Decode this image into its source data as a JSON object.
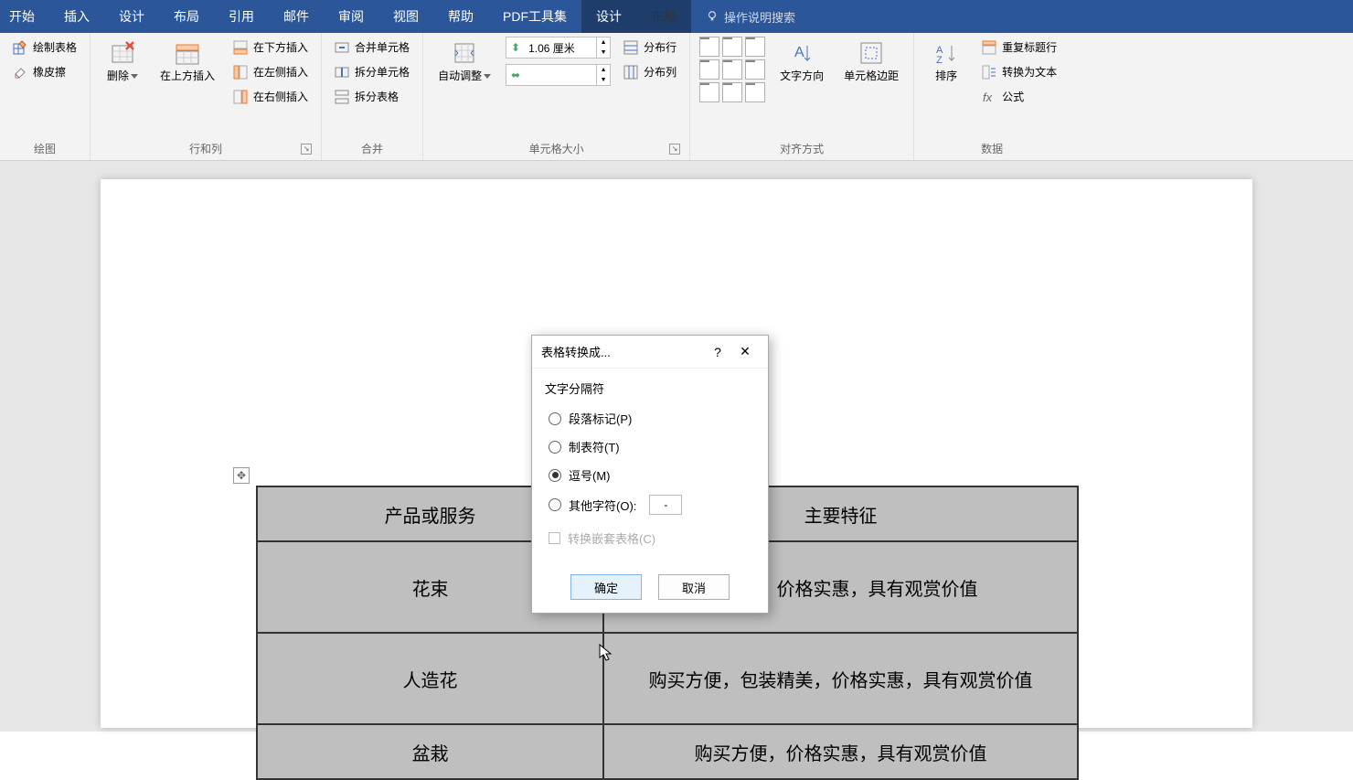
{
  "tabs": {
    "start": "开始",
    "insert": "插入",
    "design": "设计",
    "layout": "布局",
    "references": "引用",
    "mail": "邮件",
    "review": "审阅",
    "view": "视图",
    "help": "帮助",
    "pdf": "PDF工具集",
    "tbl_design": "设计",
    "tbl_layout": "布局",
    "tell_me": "操作说明搜索"
  },
  "ribbon": {
    "draw": {
      "draw_table": "绘制表格",
      "eraser": "橡皮擦",
      "group": "绘图"
    },
    "rowscols": {
      "delete": "删除",
      "insert_above": "在上方插入",
      "insert_below": "在下方插入",
      "insert_left": "在左侧插入",
      "insert_right": "在右侧插入",
      "group": "行和列"
    },
    "merge": {
      "merge_cells": "合并单元格",
      "split_cells": "拆分单元格",
      "split_table": "拆分表格",
      "group": "合并"
    },
    "cellsize": {
      "autofit": "自动调整",
      "height_value": "1.06 厘米",
      "dist_rows": "分布行",
      "dist_cols": "分布列",
      "group": "单元格大小"
    },
    "alignment": {
      "text_dir": "文字方向",
      "cell_margins": "单元格边距",
      "group": "对齐方式"
    },
    "data": {
      "sort": "排序",
      "repeat_header": "重复标题行",
      "convert_text": "转换为文本",
      "formula": "公式",
      "group": "数据"
    }
  },
  "dialog": {
    "title": "表格转换成...",
    "section": "文字分隔符",
    "opt_para": "段落标记(P)",
    "opt_tab": "制表符(T)",
    "opt_comma": "逗号(M)",
    "opt_other": "其他字符(O):",
    "other_value": "-",
    "nested": "转换嵌套表格(C)",
    "ok": "确定",
    "cancel": "取消"
  },
  "table": {
    "h1": "产品或服务",
    "h2": "主要特征",
    "r1c1": "花束",
    "r1c2": "装精美，价格实惠，具有观赏价值",
    "r2c1": "人造花",
    "r2c2": "购买方便，包装精美，价格实惠，具有观赏价值",
    "r3c1": "盆栽",
    "r3c2": "购买方便，价格实惠，具有观赏价值"
  }
}
